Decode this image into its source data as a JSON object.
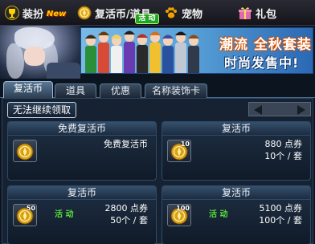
{
  "nav": {
    "dress_label": "装扮",
    "dress_badge": "New",
    "coin_label": "复活币/道具",
    "coin_badge": "活 动",
    "pet_label": "宠物",
    "gift_label": "礼包"
  },
  "banner": {
    "line1": "潮流 全秋套装",
    "line2": "时尚发售中!"
  },
  "tabs": [
    "复活币",
    "道具",
    "优惠",
    "名称装饰卡"
  ],
  "status_button": "无法继续领取",
  "items": [
    {
      "title": "免费复活币",
      "coin_count": "",
      "price": "免费复活币",
      "unit": "",
      "event": ""
    },
    {
      "title": "复活币",
      "coin_count": "10",
      "price": "880 点券",
      "unit": "10个 / 套",
      "event": ""
    },
    {
      "title": "复活币",
      "coin_count": "50",
      "price": "2800 点券",
      "unit": "50个 / 套",
      "event": "活 动"
    },
    {
      "title": "复活币",
      "coin_count": "100",
      "price": "5100 点券",
      "unit": "100个 / 套",
      "event": "活 动"
    }
  ],
  "colors": {
    "event_green": "#5adc3a",
    "badge_yellow": "#ffd200",
    "banner_orange": "#d04a00"
  }
}
